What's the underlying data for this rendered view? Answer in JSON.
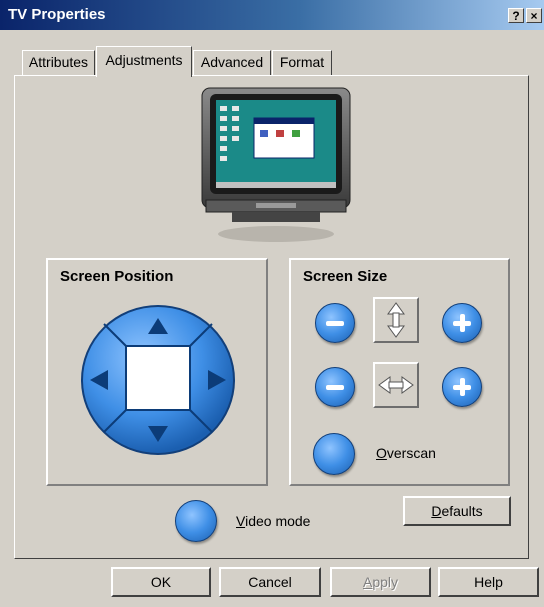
{
  "window": {
    "title": "TV Properties",
    "help_button": "?",
    "close_button": "×"
  },
  "tabs": [
    {
      "label": "Attributes",
      "active": false
    },
    {
      "label": "Adjustments",
      "active": true
    },
    {
      "label": "Advanced",
      "active": false
    },
    {
      "label": "Format",
      "active": false
    }
  ],
  "screen_position": {
    "title": "Screen Position",
    "icons": [
      "arrow-up-icon",
      "arrow-down-icon",
      "arrow-left-icon",
      "arrow-right-icon"
    ]
  },
  "screen_size": {
    "title": "Screen Size",
    "icons": [
      "minus-icon",
      "vertical-resize-icon",
      "plus-icon",
      "horizontal-resize-icon"
    ],
    "overscan_label_u": "O",
    "overscan_label_rest": "verscan"
  },
  "video_mode": {
    "label_u": "V",
    "label_rest": "ideo mode"
  },
  "defaults_button": {
    "label_u": "D",
    "label_rest": "efaults"
  },
  "footer": {
    "ok": "OK",
    "cancel": "Cancel",
    "apply_u": "A",
    "apply_rest": "pply",
    "apply_enabled": false,
    "help": "Help"
  },
  "colors": {
    "titlebar_start": "#0a246a",
    "titlebar_end": "#a6caf0",
    "dialog_bg": "#d4d0c8",
    "accent_blue": "#3f8fe6",
    "monitor_desktop": "#008080"
  }
}
